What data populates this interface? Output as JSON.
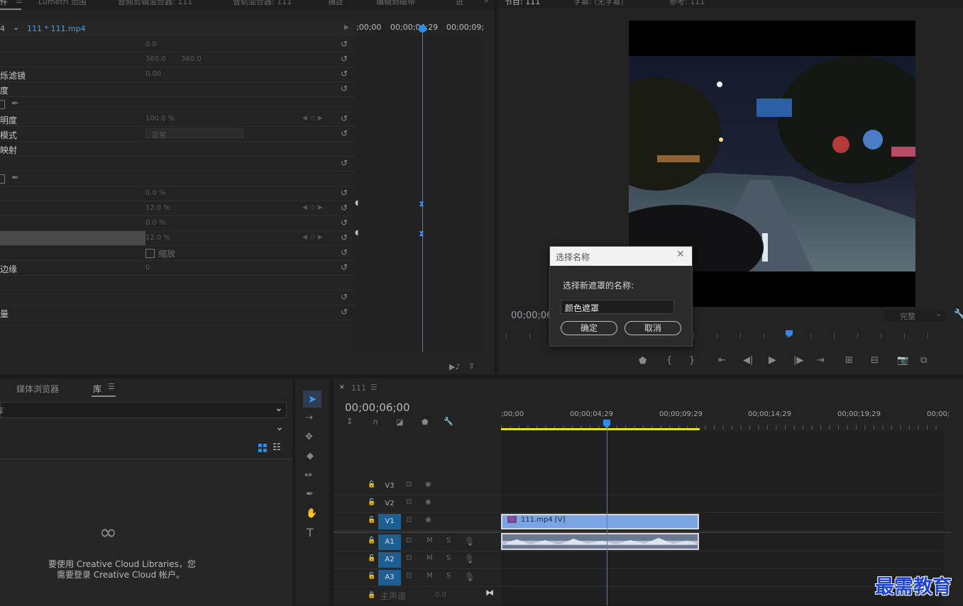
{
  "effect_controls": {
    "tabs": [
      "件",
      "Lumetri 范围",
      "音频剪辑混合器: 111",
      "音轨混合器: 111",
      "捕捉",
      "编辑到磁带",
      "进"
    ],
    "clip_prefix": "4",
    "clip_name": "111 * 111.mp4",
    "timecodes": [
      ";00;00",
      "00;00;04;29",
      "00;00;09;"
    ],
    "rows": [
      {
        "label": "",
        "v1": "0.0",
        "v2": ""
      },
      {
        "label": "",
        "v1": "360.0",
        "v2": "360.0"
      },
      {
        "label": "烁滤镜",
        "v1": "0.00",
        "v2": ""
      },
      {
        "label": "度",
        "v1": "",
        "v2": ""
      },
      {
        "label": "",
        "v1": "",
        "v2": ""
      },
      {
        "label": "明度",
        "v1": "100.0 %",
        "v2": ""
      },
      {
        "label": "模式",
        "v1": "正常",
        "v2": ""
      },
      {
        "label": "映射",
        "v1": "",
        "v2": ""
      },
      {
        "label": "",
        "v1": "",
        "v2": ""
      },
      {
        "label": "",
        "v1": "",
        "v2": ""
      },
      {
        "label": "",
        "v1": "0.0 %",
        "v2": ""
      },
      {
        "label": "",
        "v1": "12.0 %",
        "v2": ""
      },
      {
        "label": "",
        "v1": "0.0 %",
        "v2": ""
      },
      {
        "label": "",
        "v1": "12.0 %",
        "v2": ""
      },
      {
        "label": "",
        "v1": "缩放",
        "v2": ""
      },
      {
        "label": "边缘",
        "v1": "0",
        "v2": ""
      },
      {
        "label": "",
        "v1": "",
        "v2": ""
      },
      {
        "label": "",
        "v1": "",
        "v2": ""
      },
      {
        "label": "量",
        "v1": "",
        "v2": ""
      }
    ]
  },
  "program_monitor": {
    "tabs": [
      "节目: 111",
      "字幕: (无字幕)",
      "参考: 111"
    ],
    "timecode": "00;00;06",
    "fit": "完整"
  },
  "dialog": {
    "title": "选择名称",
    "prompt": "选择新遮罩的名称:",
    "input_value": "颜色遮罩",
    "ok": "确定",
    "cancel": "取消"
  },
  "library": {
    "tabs": [
      "媒体浏览器",
      "库"
    ],
    "dropdown1": "库",
    "message_line1": "要使用 Creative Cloud Libraries，您",
    "message_line2": "需要登录 Creative Cloud 帐户。"
  },
  "timeline": {
    "sequence_name": "111",
    "timecode": "00;00;06;00",
    "ruler": [
      ";00;00",
      "00;00;04;29",
      "00;00;09;29",
      "00;00;14;29",
      "00;00;19;29",
      "00;00;"
    ],
    "tracks": [
      {
        "name": "V3",
        "type": "video",
        "active": false
      },
      {
        "name": "V2",
        "type": "video",
        "active": false
      },
      {
        "name": "V1",
        "type": "video",
        "active": true
      },
      {
        "name": "A1",
        "type": "audio",
        "active": true
      },
      {
        "name": "A2",
        "type": "audio",
        "active": true
      },
      {
        "name": "A3",
        "type": "audio",
        "active": true
      }
    ],
    "video_clip": "111.mp4 [V]",
    "fx_badge": "fx",
    "master_label": "主声道",
    "master_value": "0.0",
    "audio_mute": "M",
    "audio_solo": "S"
  },
  "watermark": "最需教育"
}
